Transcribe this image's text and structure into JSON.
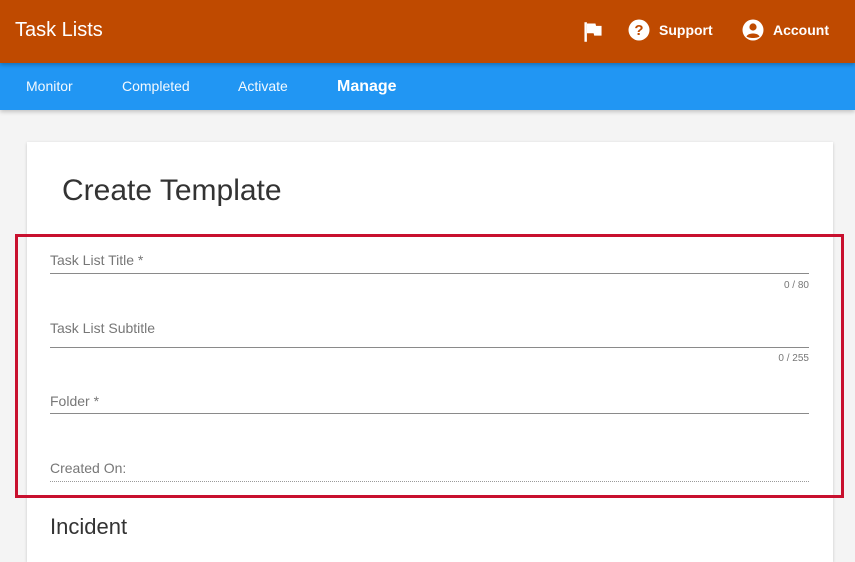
{
  "app": {
    "title": "Task Lists"
  },
  "header": {
    "flag_icon": "flag-icon",
    "support_label": "Support",
    "support_icon": "help-circle-icon",
    "account_label": "Account",
    "account_icon": "account-circle-icon"
  },
  "nav": {
    "tabs": [
      {
        "label": "Monitor",
        "active": false
      },
      {
        "label": "Completed",
        "active": false
      },
      {
        "label": "Activate",
        "active": false
      },
      {
        "label": "Manage",
        "active": true
      }
    ]
  },
  "page": {
    "title": "Create Template",
    "fields": {
      "title": {
        "label": "Task List Title *",
        "counter": "0 / 80"
      },
      "subtitle": {
        "label": "Task List Subtitle",
        "counter": "0 / 255"
      },
      "folder": {
        "label": "Folder *"
      },
      "created_on": {
        "label": "Created On:"
      }
    },
    "section_title": "Incident"
  },
  "colors": {
    "header_bg": "#bf4a00",
    "nav_bg": "#2196f3",
    "highlight": "#c8102e"
  }
}
